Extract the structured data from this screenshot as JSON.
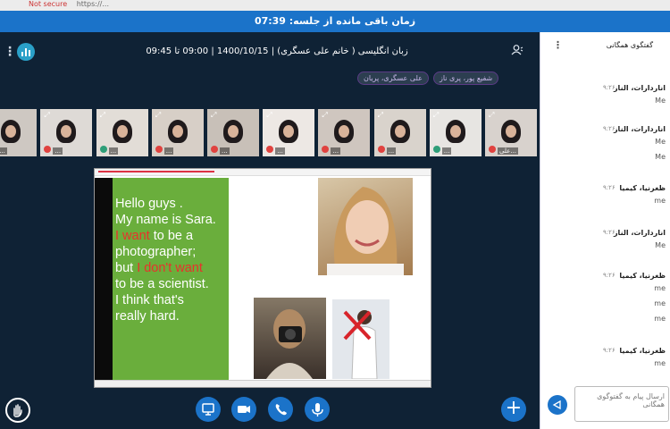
{
  "browser": {
    "security": "Not secure",
    "url": "https://..."
  },
  "timer": {
    "label": "زمان باقی مانده از جلسه: 07:39"
  },
  "meeting": {
    "title": "زبان انگلیسی ( خانم علی عسگری) | 1400/10/15 | 09:00 تا 09:45"
  },
  "presenters": [
    "شفیع پور، پری ناز",
    "علی عسگری، پریان"
  ],
  "videos": [
    {
      "name": "علی...",
      "mic": "off"
    },
    {
      "name": "...",
      "mic": "on"
    },
    {
      "name": "...",
      "mic": "off"
    },
    {
      "name": "...",
      "mic": "off"
    },
    {
      "name": "...",
      "mic": "off"
    },
    {
      "name": "...",
      "mic": "off"
    },
    {
      "name": "...",
      "mic": "off"
    },
    {
      "name": "...",
      "mic": "on"
    },
    {
      "name": "...",
      "mic": "off"
    },
    {
      "name": "...",
      "mic": "off"
    }
  ],
  "slide": {
    "lines": [
      {
        "text": "Hello guys ."
      },
      {
        "text": "My name is Sara."
      },
      {
        "red": "I want",
        "text": " to be a"
      },
      {
        "text": "photographer;"
      },
      {
        "text": "but ",
        "red": "I don't want"
      },
      {
        "text": "to be a scientist."
      },
      {
        "text": "I think that's"
      },
      {
        "text": "really hard."
      }
    ]
  },
  "chat": {
    "title": "گفتگوی همگانی",
    "messages": [
      {
        "author": "اناردارات، الناز",
        "time": "۹:۲۶",
        "lines": [
          "Me"
        ]
      },
      {
        "author": "اناردارات، الناز",
        "time": "۹:۲۶",
        "lines": [
          "Me",
          "Me"
        ]
      },
      {
        "author": "ظغرنیا، کیمیا",
        "time": "۹:۲۶",
        "lines": [
          "me"
        ]
      },
      {
        "author": "اناردارات، الناز",
        "time": "۹:۲۶",
        "lines": [
          "Me"
        ]
      },
      {
        "author": "ظغرنیا، کیمیا",
        "time": "۹:۲۶",
        "lines": [
          "me",
          "me",
          "me"
        ]
      },
      {
        "author": "ظغرنیا، کیمیا",
        "time": "۹:۲۶",
        "lines": [
          "me"
        ]
      }
    ],
    "input_placeholder": "ارسال پیام به گفتوگوی همگانی"
  },
  "colors": {
    "accent": "#1b73c9",
    "background": "#0f2235",
    "slide_green": "#6aae3c",
    "slide_red": "#e8322b"
  }
}
